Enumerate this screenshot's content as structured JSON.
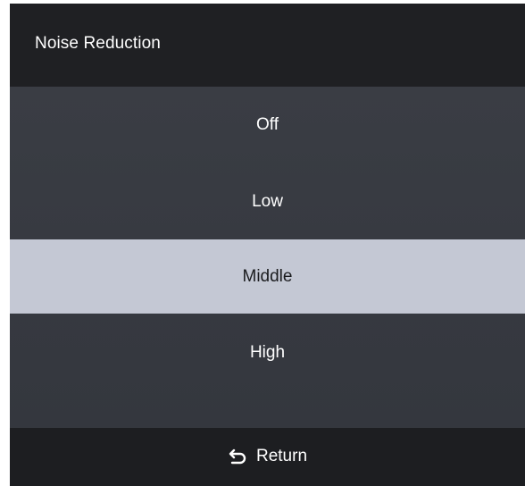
{
  "header": {
    "title": "Noise Reduction"
  },
  "menu": {
    "items": [
      {
        "label": "Off",
        "selected": false
      },
      {
        "label": "Low",
        "selected": false
      },
      {
        "label": "Middle",
        "selected": true
      },
      {
        "label": "High",
        "selected": false
      }
    ]
  },
  "footer": {
    "return_label": "Return",
    "return_icon": "return-arrow-icon"
  },
  "colors": {
    "header_bg": "#1f2023",
    "menu_bg": "#383b42",
    "selected_bg": "#c4c8d4",
    "footer_bg": "#1d1e21",
    "text": "#ffffff"
  }
}
